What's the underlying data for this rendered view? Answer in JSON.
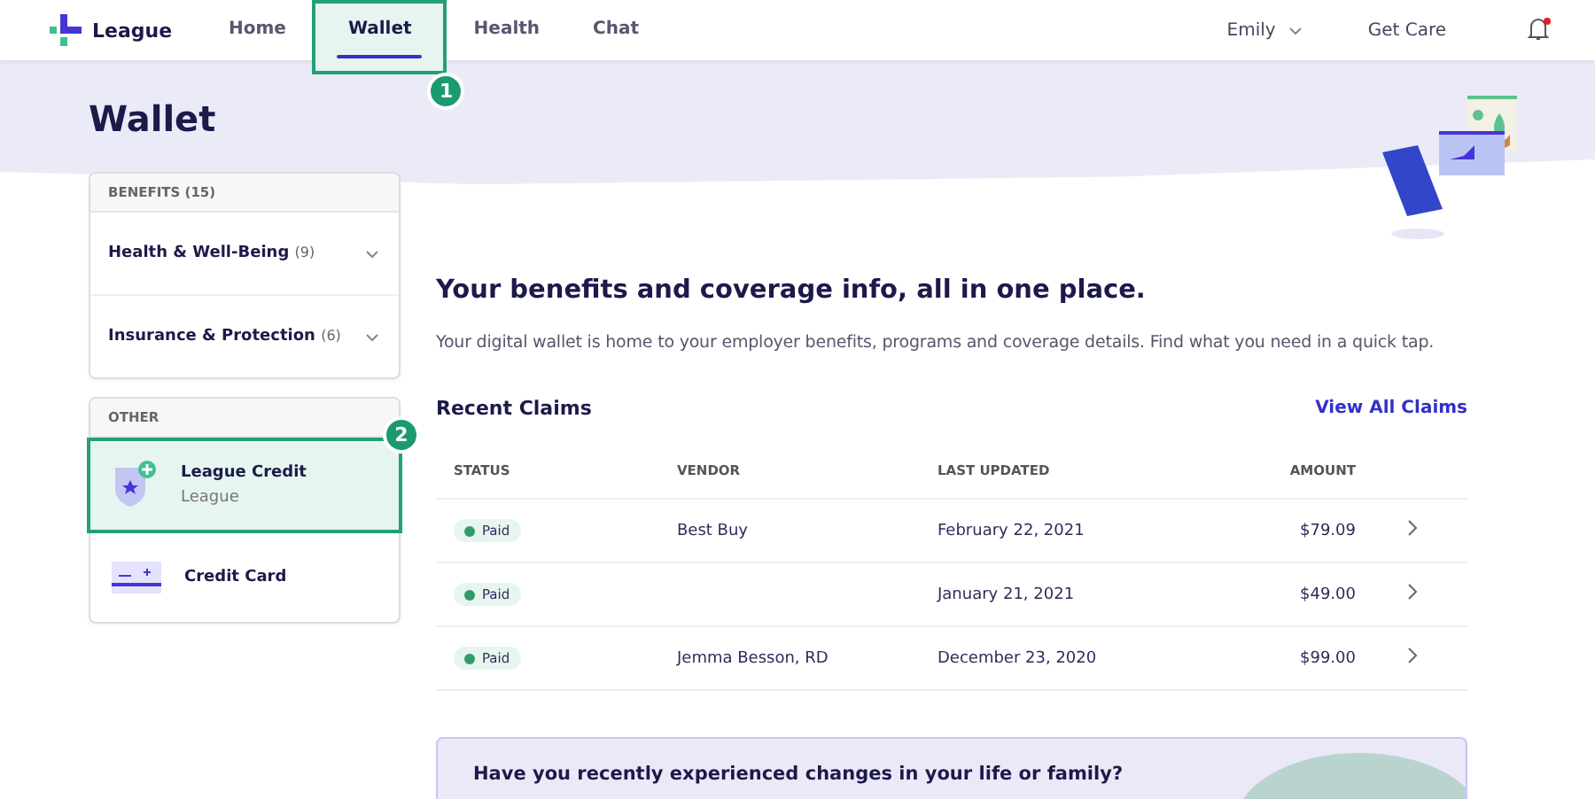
{
  "header": {
    "logo": "League",
    "nav": [
      {
        "label": "Home",
        "selected": false
      },
      {
        "label": "Wallet",
        "selected": true,
        "callout": "1"
      },
      {
        "label": "Health",
        "selected": false
      },
      {
        "label": "Chat",
        "selected": false
      }
    ],
    "user": "Emily",
    "get_care": "Get Care",
    "has_notification": true
  },
  "title": "Wallet",
  "benefits": {
    "heading": "BENEFITS",
    "count": "(15)",
    "items": [
      {
        "label": "Health & Well-Being",
        "count": "(9)",
        "expanded": false
      },
      {
        "label": "Insurance & Protection",
        "count": "(6)",
        "expanded": false
      }
    ]
  },
  "other": {
    "heading": "OTHER",
    "items": [
      {
        "kind": "credit",
        "label": "League Credit",
        "sublabel": "League",
        "selected": true,
        "callout": "2"
      },
      {
        "kind": "card",
        "label": "Credit Card",
        "selected": false
      }
    ]
  },
  "intro": {
    "heading": "Your benefits and coverage info, all in one place.",
    "text": "Your digital wallet is home to your employer benefits, programs and coverage details. Find what you need in a quick tap."
  },
  "claims": {
    "title": "Recent Claims",
    "link": "View All Claims",
    "columns": [
      "STATUS",
      "VENDOR",
      "LAST UPDATED",
      "AMOUNT"
    ],
    "rows": [
      {
        "status": "Paid",
        "vendor": "Best Buy",
        "updated": "February 22, 2021",
        "amount": "$79.09"
      },
      {
        "status": "Paid",
        "vendor": "",
        "updated": "January 21, 2021",
        "amount": "$49.00"
      },
      {
        "status": "Paid",
        "vendor": "Jemma Besson, RD",
        "updated": "December 23, 2020",
        "amount": "$99.00"
      }
    ]
  },
  "banner": {
    "heading": "Have you recently experienced changes in your life or family?"
  }
}
